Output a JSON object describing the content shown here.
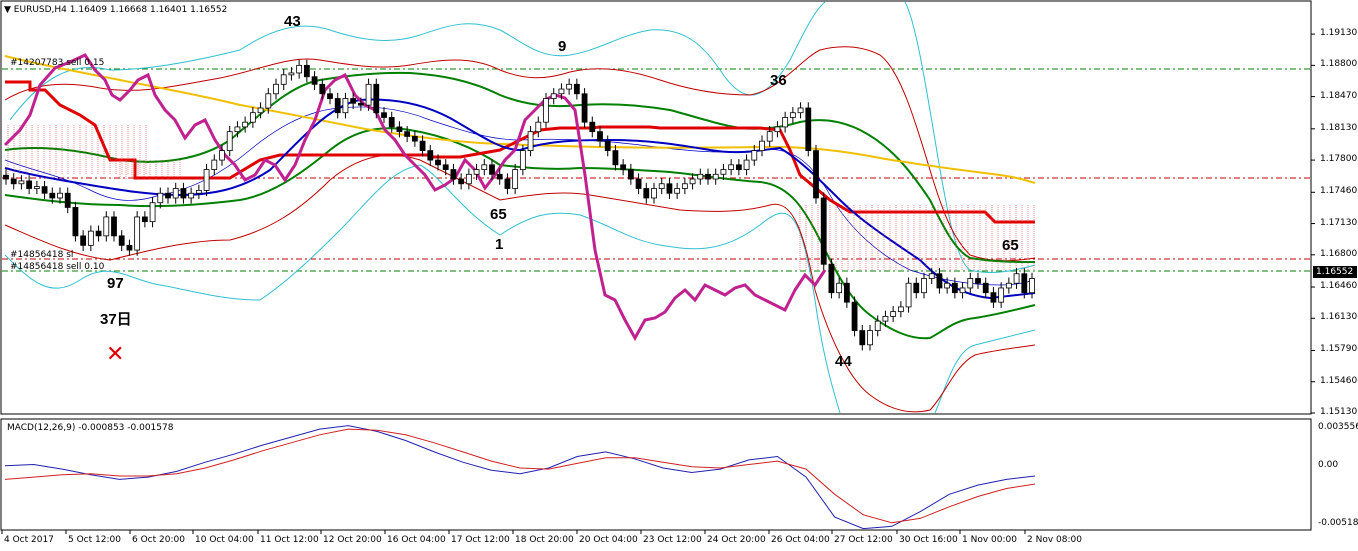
{
  "window": {
    "title_symbol": "EURUSD,H4",
    "ohlc": [
      "1.16409",
      "1.16668",
      "1.16401",
      "1.16552"
    ],
    "triangle_icon": "triangle-down-icon"
  },
  "orders": {
    "sell_1": "#14207783 sell 0.15",
    "sl_1": "#14856418 sl",
    "sell_2": "#14856418 sell 0.10"
  },
  "annotations": {
    "n43": "43",
    "n9": "9",
    "n36": "36",
    "n65a": "65",
    "n1": "1",
    "n97": "97",
    "n37": "37日",
    "n65b": "65",
    "n44": "44",
    "x_mark": "✕"
  },
  "price_scale": {
    "ticks": [
      "1.19130",
      "1.18800",
      "1.18470",
      "1.18130",
      "1.17800",
      "1.17460",
      "1.17130",
      "1.16800",
      "1.16460",
      "1.16130",
      "1.15790",
      "1.15460",
      "1.15130"
    ],
    "current": "1.16552"
  },
  "macd": {
    "label": "MACD(12,26,9) -0.000853 -0.001578",
    "ticks": [
      "0.003556",
      "0.00",
      "-0.005188"
    ]
  },
  "time_axis": [
    "4 Oct 2017",
    "5 Oct 12:00",
    "6 Oct 20:00",
    "10 Oct 04:00",
    "11 Oct 12:00",
    "12 Oct 20:00",
    "16 Oct 04:00",
    "17 Oct 12:00",
    "18 Oct 20:00",
    "20 Oct 04:00",
    "23 Oct 12:00",
    "24 Oct 20:00",
    "26 Oct 04:00",
    "27 Oct 12:00",
    "30 Oct 16:00",
    "1 Nov 00:00",
    "2 Nov 08:00"
  ],
  "colors": {
    "background": "#ffffff",
    "candle": "#000000",
    "tenkan": "#e00000",
    "kijun_blue": "#0000c0",
    "envelope_green": "#008000",
    "slow_ma": "#f0c000",
    "stoch": "#c02090",
    "bands_red": "#c00000",
    "bands_cyan": "#30c0d0",
    "cloud_hatch": "#e04040",
    "macd_main": "#2020b0",
    "macd_signal": "#d02020",
    "level_green": "#008000",
    "level_red": "#c00000"
  },
  "chart_data": {
    "type": "candlestick",
    "symbol": "EURUSD",
    "timeframe": "H4",
    "ylim": [
      1.1513,
      1.193
    ],
    "current_price": 1.16552,
    "horizontal_levels": [
      {
        "price": 1.1862,
        "color": "green",
        "label": "#14207783 sell 0.15"
      },
      {
        "price": 1.1752,
        "color": "red",
        "label": ""
      },
      {
        "price": 1.1671,
        "color": "red",
        "label": "#14856418 sl"
      },
      {
        "price": 1.166,
        "color": "green",
        "label": "#14856418 sell 0.10"
      }
    ],
    "closes": [
      1.176,
      1.1755,
      1.1758,
      1.175,
      1.1752,
      1.1745,
      1.174,
      1.1745,
      1.173,
      1.17,
      1.169,
      1.1705,
      1.17,
      1.172,
      1.17,
      1.169,
      1.1685,
      1.172,
      1.1715,
      1.1735,
      1.1745,
      1.174,
      1.175,
      1.174,
      1.1745,
      1.1748,
      1.177,
      1.178,
      1.179,
      1.181,
      1.1815,
      1.182,
      1.183,
      1.1835,
      1.185,
      1.186,
      1.187,
      1.1872,
      1.188,
      1.1868,
      1.186,
      1.185,
      1.1845,
      1.183,
      1.1845,
      1.184,
      1.1838,
      1.186,
      1.183,
      1.1825,
      1.1815,
      1.181,
      1.1805,
      1.18,
      1.179,
      1.178,
      1.1775,
      1.177,
      1.176,
      1.1755,
      1.1765,
      1.177,
      1.1775,
      1.1765,
      1.176,
      1.175,
      1.177,
      1.179,
      1.181,
      1.182,
      1.1845,
      1.185,
      1.1855,
      1.186,
      1.185,
      1.182,
      1.181,
      1.18,
      1.179,
      1.1775,
      1.177,
      1.176,
      1.175,
      1.174,
      1.175,
      1.1755,
      1.1745,
      1.175,
      1.1755,
      1.176,
      1.1765,
      1.176,
      1.1765,
      1.177,
      1.1775,
      1.177,
      1.178,
      1.179,
      1.18,
      1.181,
      1.1815,
      1.1825,
      1.183,
      1.1835,
      1.179,
      1.174,
      1.167,
      1.164,
      1.165,
      1.163,
      1.16,
      1.1585,
      1.16,
      1.161,
      1.1615,
      1.162,
      1.1625,
      1.165,
      1.164,
      1.1655,
      1.166,
      1.1645,
      1.165,
      1.164,
      1.1645,
      1.1655,
      1.165,
      1.164,
      1.163,
      1.1645,
      1.165,
      1.166,
      1.164,
      1.1655
    ],
    "macd_main": [
      0.0,
      0.0001,
      -0.0003,
      -0.0008,
      -0.0012,
      -0.001,
      -0.0005,
      0.0003,
      0.001,
      0.0018,
      0.0025,
      0.0032,
      0.0035,
      0.003,
      0.0022,
      0.0012,
      0.0003,
      -0.0004,
      -0.0007,
      -0.0002,
      0.0008,
      0.0012,
      0.0006,
      -0.0002,
      -0.0006,
      -0.0003,
      0.0005,
      0.0008,
      -0.001,
      -0.0045,
      -0.0055,
      -0.0053,
      -0.004,
      -0.0025,
      -0.0017,
      -0.0012,
      -0.0009
    ],
    "macd_signal": [
      -0.0012,
      -0.001,
      -0.0008,
      -0.0007,
      -0.0009,
      -0.0009,
      -0.0007,
      -0.0002,
      0.0005,
      0.0013,
      0.002,
      0.0027,
      0.0032,
      0.0031,
      0.0027,
      0.002,
      0.0012,
      0.0004,
      -0.0002,
      -0.0003,
      0.0002,
      0.0007,
      0.0007,
      0.0003,
      -0.0001,
      -0.0002,
      0.0001,
      0.0004,
      -0.0003,
      -0.0025,
      -0.0043,
      -0.005,
      -0.0046,
      -0.0036,
      -0.0027,
      -0.002,
      -0.0016
    ]
  }
}
